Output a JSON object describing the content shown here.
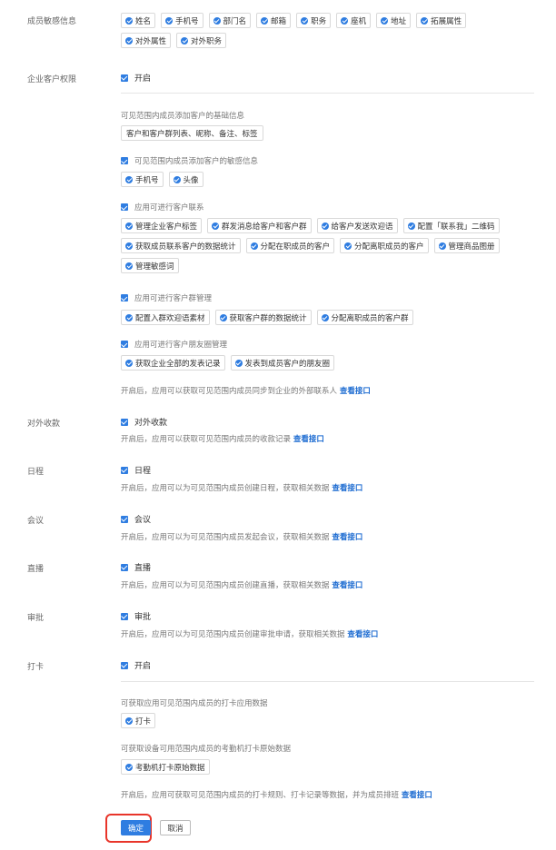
{
  "sensitive": {
    "label": "成员敏感信息",
    "chips": [
      "姓名",
      "手机号",
      "部门名",
      "邮箱",
      "职务",
      "座机",
      "地址",
      "拓展属性",
      "对外属性",
      "对外职务"
    ]
  },
  "customer": {
    "label": "企业客户权限",
    "enable_text": "开启",
    "basic_title": "可见范围内成员添加客户的基础信息",
    "basic_chip": "客户和客户群列表、昵称、备注、标签",
    "sensitive_title": "可见范围内成员添加客户的敏感信息",
    "sensitive_chips": [
      "手机号",
      "头像"
    ],
    "contact_title": "应用可进行客户联系",
    "contact_chips": [
      "管理企业客户标签",
      "群发消息给客户和客户群",
      "给客户发送欢迎语",
      "配置「联系我」二维码",
      "获取成员联系客户的数据统计",
      "分配在职成员的客户",
      "分配离职成员的客户",
      "管理商品图册",
      "管理敏感词"
    ],
    "group_title": "应用可进行客户群管理",
    "group_chips": [
      "配置入群欢迎语素材",
      "获取客户群的数据统计",
      "分配离职成员的客户群"
    ],
    "moments_title": "应用可进行客户朋友圈管理",
    "moments_chips": [
      "获取企业全部的发表记录",
      "发表到成员客户的朋友圈"
    ],
    "note": "开启后，应用可以获取可见范围内成员同步到企业的外部联系人",
    "link": "查看接口"
  },
  "payment": {
    "label": "对外收款",
    "check": "对外收款",
    "note": "开启后，应用可以获取可见范围内成员的收款记录",
    "link": "查看接口"
  },
  "schedule": {
    "label": "日程",
    "check": "日程",
    "note": "开启后，应用可以为可见范围内成员创建日程，获取相关数据",
    "link": "查看接口"
  },
  "meeting": {
    "label": "会议",
    "check": "会议",
    "note": "开启后，应用可以为可见范围内成员发起会议，获取相关数据",
    "link": "查看接口"
  },
  "live": {
    "label": "直播",
    "check": "直播",
    "note": "开启后，应用可以为可见范围内成员创建直播，获取相关数据",
    "link": "查看接口"
  },
  "approval": {
    "label": "审批",
    "check": "审批",
    "note": "开启后，应用可以为可见范围内成员创建审批申请，获取相关数据",
    "link": "查看接口"
  },
  "checkin": {
    "label": "打卡",
    "enable_text": "开启",
    "app_title": "可获取应用可见范围内成员的打卡应用数据",
    "app_chip": "打卡",
    "device_title": "可获取设备可用范围内成员的考勤机打卡原始数据",
    "device_chip": "考勤机打卡原始数据",
    "note": "开启后，应用可获取可见范围内成员的打卡规则、打卡记录等数据，并为成员排班",
    "link": "查看接口"
  },
  "buttons": {
    "confirm": "确定",
    "cancel": "取消"
  },
  "colors": {
    "accent": "#2f7de1",
    "highlight": "#e8352a"
  }
}
